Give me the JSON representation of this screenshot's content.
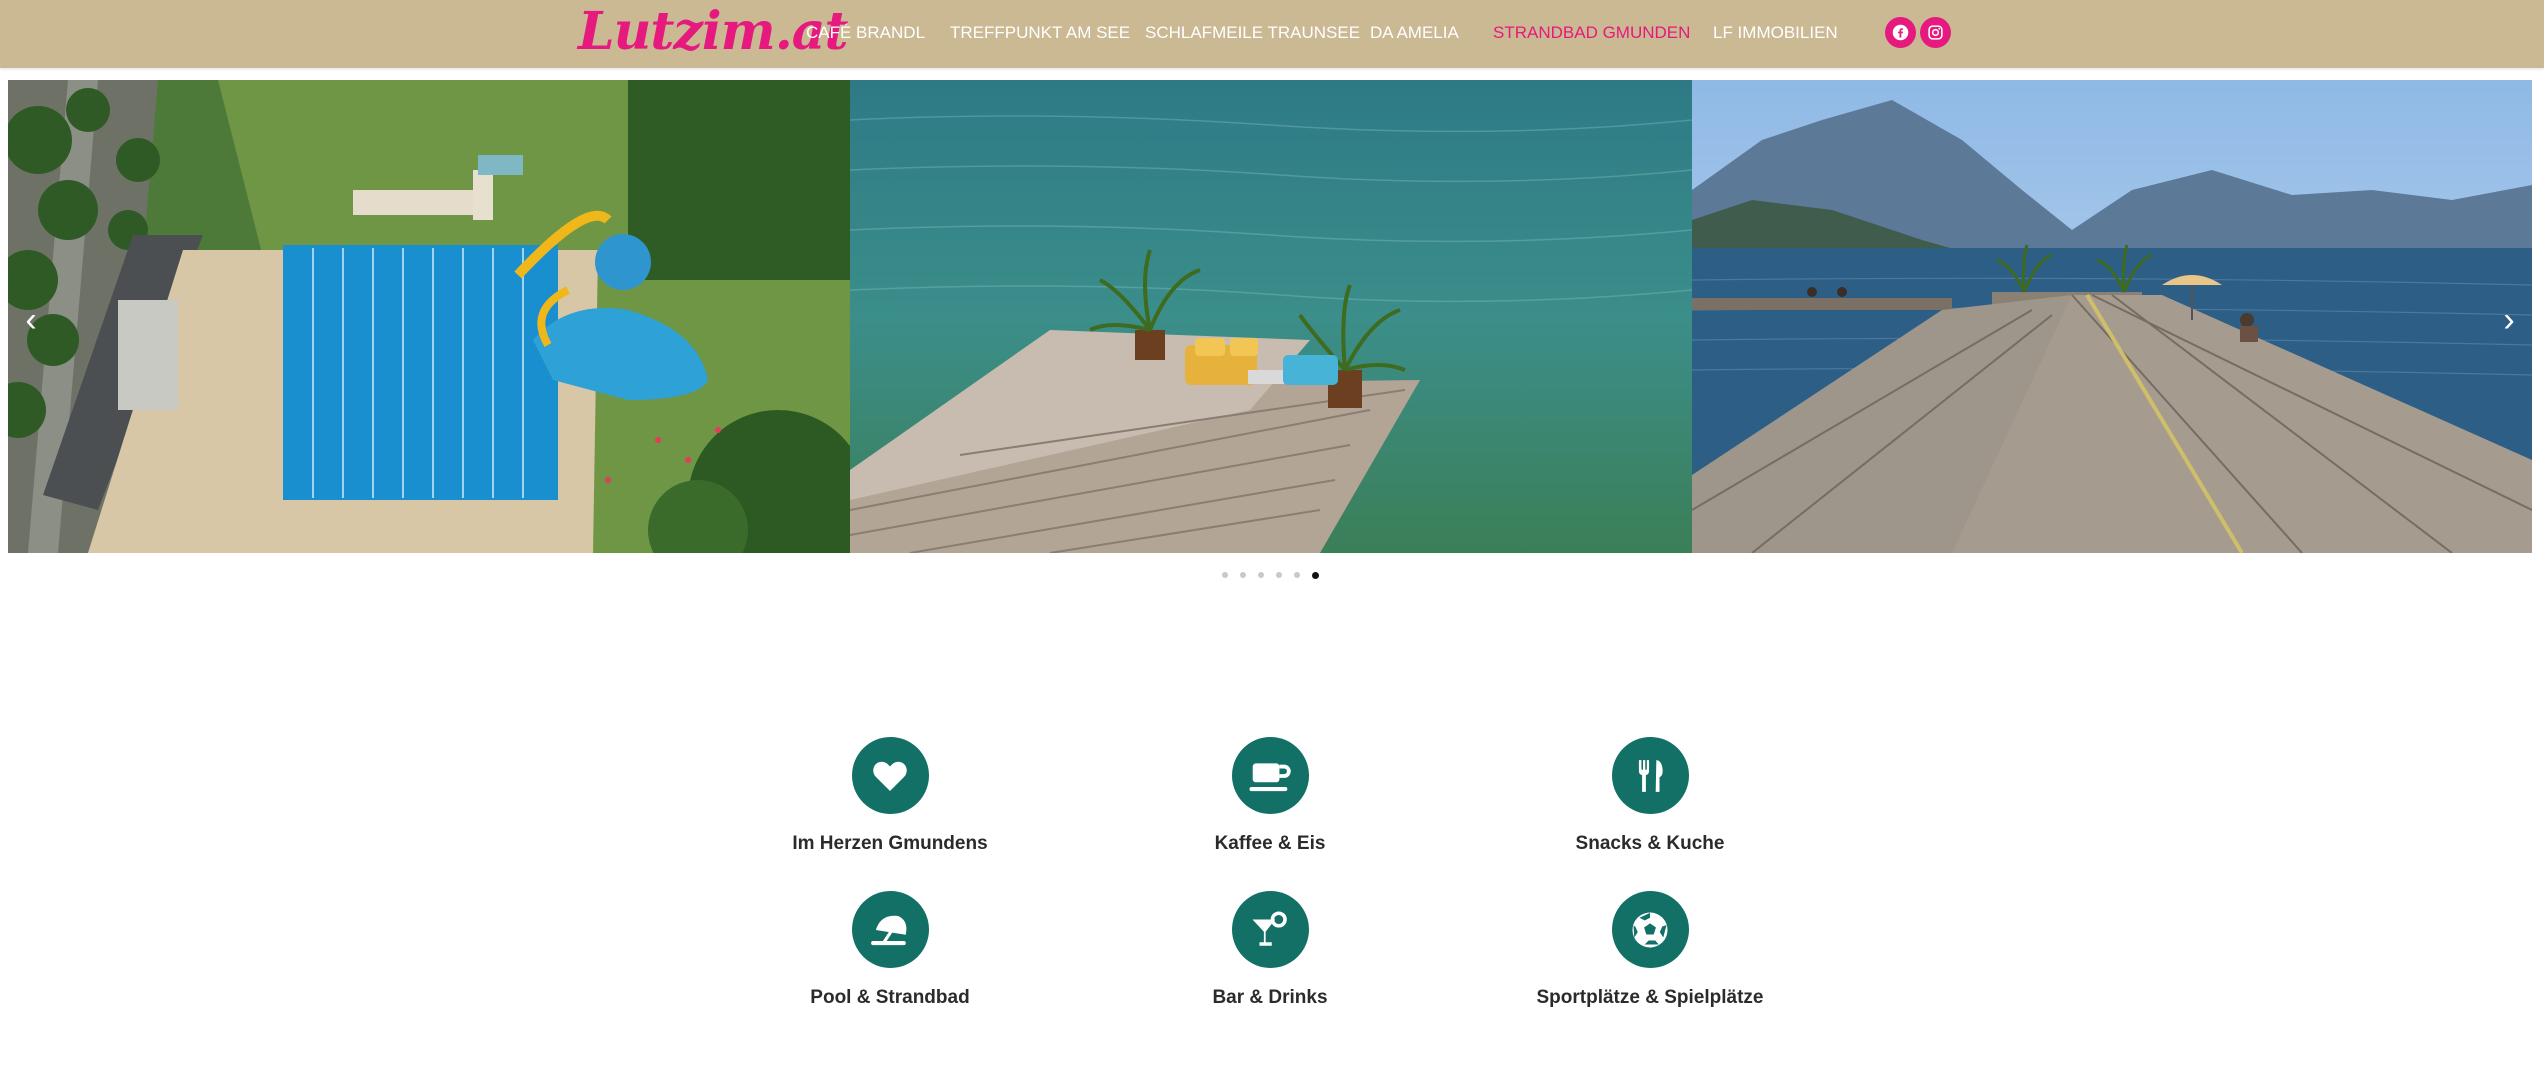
{
  "header": {
    "logo_text": "Lutzim.at",
    "nav": [
      {
        "label": "CAFÉ BRANDL"
      },
      {
        "label": "TREFFPUNKT AM SEE"
      },
      {
        "label": "SCHLAFMEILE TRAUNSEE"
      },
      {
        "label": "DA AMELIA"
      },
      {
        "label": "STRANDBAD GMUNDEN",
        "active": true
      },
      {
        "label": "LF IMMOBILIEN"
      }
    ],
    "social": [
      "facebook-icon",
      "instagram-icon"
    ]
  },
  "slider": {
    "slides": [
      "aerial-pool-photo",
      "lake-dock-lounge-photo",
      "lake-pier-mountains-photo"
    ],
    "dots_count": 6,
    "active_dot": 6
  },
  "features": [
    {
      "label": "Im Herzen Gmundens",
      "icon": "heart-icon"
    },
    {
      "label": "Kaffee & Eis",
      "icon": "coffee-cup-icon"
    },
    {
      "label": "Snacks & Kuche",
      "icon": "utensils-icon"
    },
    {
      "label": "Pool & Strandbad",
      "icon": "beach-umbrella-icon"
    },
    {
      "label": "Bar & Drinks",
      "icon": "cocktail-icon"
    },
    {
      "label": "Sportplätze & Spielplätze",
      "icon": "football-icon"
    }
  ],
  "colors": {
    "header_bg": "#cbb994",
    "accent": "#e5197e",
    "icon_circle": "#137066"
  }
}
